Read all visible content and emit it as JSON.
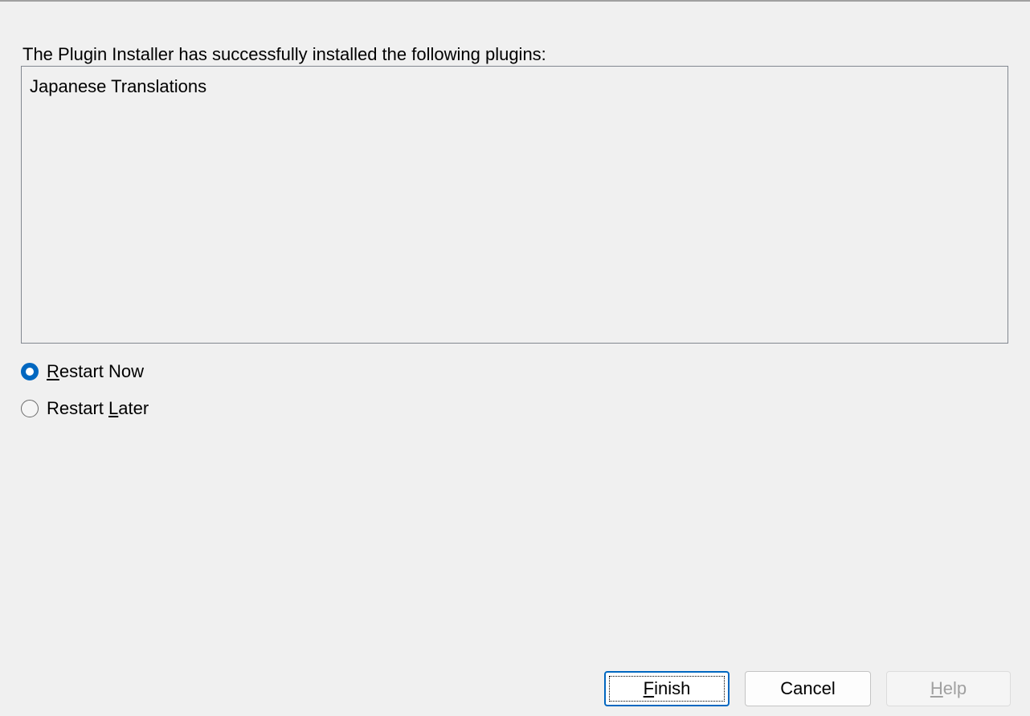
{
  "intro": {
    "text": "The Plugin Installer has successfully installed the following plugins:"
  },
  "installed_plugins": [
    "Japanese Translations"
  ],
  "restart_options": [
    {
      "mnemonic": "R",
      "rest": "estart Now",
      "selected": true
    },
    {
      "prefix": "Restart ",
      "mnemonic": "L",
      "rest": "ater",
      "selected": false
    }
  ],
  "buttons": {
    "finish": {
      "mnemonic": "F",
      "rest": "inish",
      "default": true,
      "enabled": true
    },
    "cancel": {
      "label": "Cancel",
      "enabled": true
    },
    "help": {
      "mnemonic": "H",
      "rest": "elp",
      "enabled": false
    }
  },
  "colors": {
    "background": "#f0f0f0",
    "accent": "#0067c0",
    "disabled_text": "#a0a0a0"
  }
}
